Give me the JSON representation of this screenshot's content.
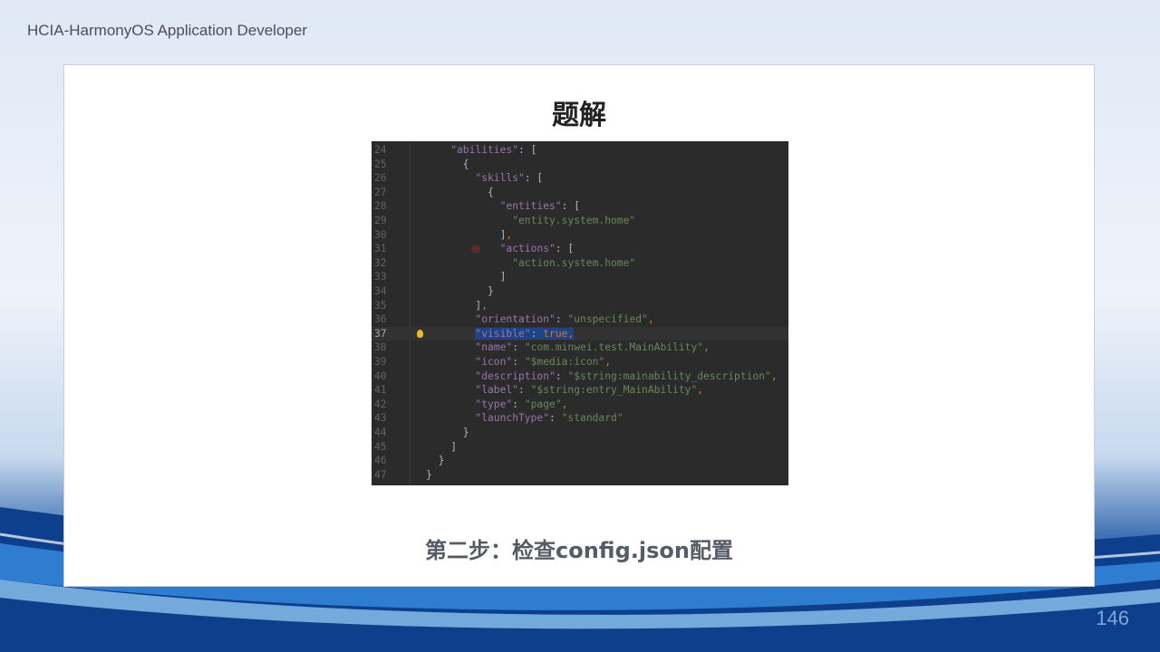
{
  "header": {
    "title": "HCIA-HarmonyOS Application Developer"
  },
  "slide": {
    "title": "题解",
    "caption": "第二步：检查config.json配置",
    "page_number": "146"
  },
  "code": {
    "current_line": 37,
    "lines": [
      {
        "n": "24",
        "indent": 2,
        "tokens": [
          [
            "k",
            "\"abilities\""
          ],
          [
            "p",
            ": ["
          ]
        ]
      },
      {
        "n": "25",
        "indent": 3,
        "tokens": [
          [
            "p",
            "{"
          ]
        ]
      },
      {
        "n": "26",
        "indent": 4,
        "tokens": [
          [
            "k",
            "\"skills\""
          ],
          [
            "p",
            ": ["
          ]
        ]
      },
      {
        "n": "27",
        "indent": 5,
        "tokens": [
          [
            "p",
            "{"
          ]
        ]
      },
      {
        "n": "28",
        "indent": 6,
        "tokens": [
          [
            "k",
            "\"entities\""
          ],
          [
            "p",
            ": ["
          ]
        ]
      },
      {
        "n": "29",
        "indent": 7,
        "tokens": [
          [
            "s",
            "\"entity.system.home\""
          ]
        ]
      },
      {
        "n": "30",
        "indent": 6,
        "tokens": [
          [
            "p",
            "]"
          ],
          [
            "b",
            ","
          ]
        ]
      },
      {
        "n": "31",
        "indent": 6,
        "tokens": [
          [
            "k",
            "\"actions\""
          ],
          [
            "p",
            ": ["
          ]
        ]
      },
      {
        "n": "32",
        "indent": 7,
        "tokens": [
          [
            "s",
            "\"action.system.home\""
          ]
        ]
      },
      {
        "n": "33",
        "indent": 6,
        "tokens": [
          [
            "p",
            "]"
          ]
        ]
      },
      {
        "n": "34",
        "indent": 5,
        "tokens": [
          [
            "p",
            "}"
          ]
        ]
      },
      {
        "n": "35",
        "indent": 4,
        "tokens": [
          [
            "p",
            "]"
          ],
          [
            "b",
            ","
          ]
        ]
      },
      {
        "n": "36",
        "indent": 4,
        "tokens": [
          [
            "k",
            "\"orientation\""
          ],
          [
            "p",
            ": "
          ],
          [
            "s",
            "\"unspecified\""
          ],
          [
            "b",
            ","
          ]
        ]
      },
      {
        "n": "37",
        "indent": 4,
        "tokens": [
          [
            "k",
            "\"visible\""
          ],
          [
            "p",
            ": "
          ],
          [
            "b",
            "true"
          ],
          [
            "b",
            ","
          ]
        ],
        "selected": true
      },
      {
        "n": "38",
        "indent": 4,
        "tokens": [
          [
            "k",
            "\"name\""
          ],
          [
            "p",
            ": "
          ],
          [
            "s",
            "\"com.minwei.test.MainAbility\""
          ],
          [
            "b",
            ","
          ]
        ]
      },
      {
        "n": "39",
        "indent": 4,
        "tokens": [
          [
            "k",
            "\"icon\""
          ],
          [
            "p",
            ": "
          ],
          [
            "s",
            "\"$media:icon\""
          ],
          [
            "b",
            ","
          ]
        ]
      },
      {
        "n": "40",
        "indent": 4,
        "tokens": [
          [
            "k",
            "\"description\""
          ],
          [
            "p",
            ": "
          ],
          [
            "s",
            "\"$string:mainability_description\""
          ],
          [
            "b",
            ","
          ]
        ]
      },
      {
        "n": "41",
        "indent": 4,
        "tokens": [
          [
            "k",
            "\"label\""
          ],
          [
            "p",
            ": "
          ],
          [
            "s",
            "\"$string:entry_MainAbility\""
          ],
          [
            "b",
            ","
          ]
        ]
      },
      {
        "n": "42",
        "indent": 4,
        "tokens": [
          [
            "k",
            "\"type\""
          ],
          [
            "p",
            ": "
          ],
          [
            "s",
            "\"page\""
          ],
          [
            "b",
            ","
          ]
        ]
      },
      {
        "n": "43",
        "indent": 4,
        "tokens": [
          [
            "k",
            "\"launchType\""
          ],
          [
            "p",
            ": "
          ],
          [
            "s",
            "\"standard\""
          ]
        ]
      },
      {
        "n": "44",
        "indent": 3,
        "tokens": [
          [
            "p",
            "}"
          ]
        ]
      },
      {
        "n": "45",
        "indent": 2,
        "tokens": [
          [
            "p",
            "]"
          ]
        ]
      },
      {
        "n": "46",
        "indent": 1,
        "tokens": [
          [
            "p",
            "}"
          ]
        ]
      },
      {
        "n": "47",
        "indent": 0,
        "tokens": [
          [
            "p",
            "}"
          ]
        ]
      }
    ]
  },
  "colors": {
    "editor_bg": "#2b2b2b",
    "key": "#9876aa",
    "string": "#6a8759",
    "keyword": "#cc7832",
    "selection": "#214283"
  }
}
